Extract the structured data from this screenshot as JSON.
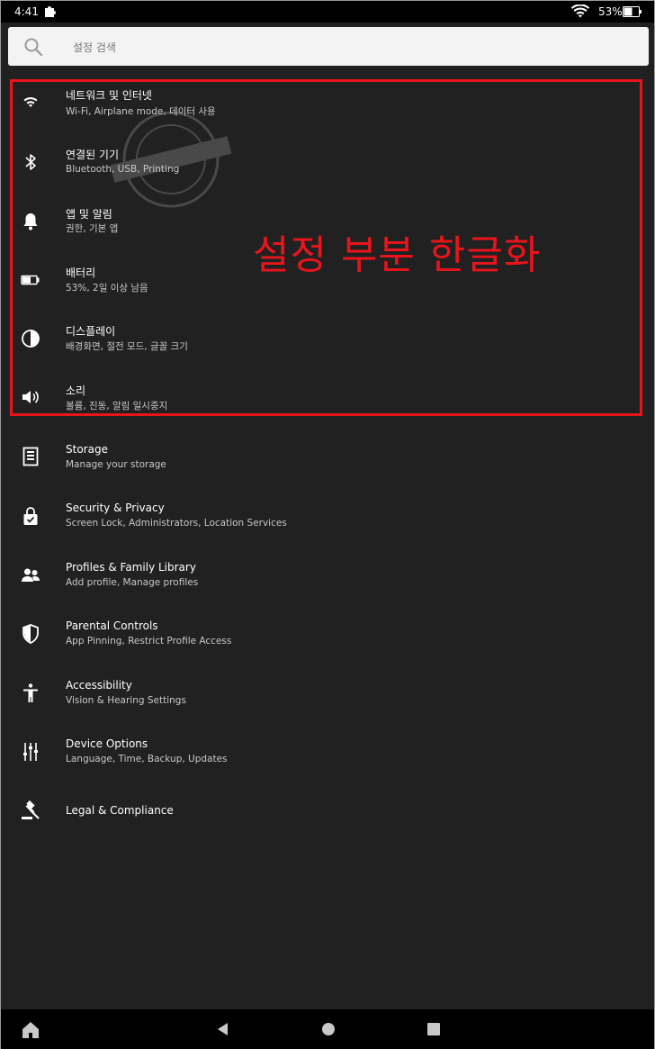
{
  "status_bar": {
    "time": "4:41",
    "battery_percent": "53%",
    "battery_level": 0.53,
    "icons": [
      "puzzle-icon",
      "wifi-icon",
      "battery-icon"
    ]
  },
  "search": {
    "placeholder": "설정 검색",
    "icon": "search-icon"
  },
  "settings": [
    {
      "icon": "wifi-icon",
      "title": "네트워크 및 인터넷",
      "subtitle": "Wi-Fi, Airplane mode, 데이터 사용"
    },
    {
      "icon": "bluetooth-icon",
      "title": "연결된 기기",
      "subtitle": "Bluetooth, USB, Printing"
    },
    {
      "icon": "bell-icon",
      "title": "앱 및 알림",
      "subtitle": "권한, 기본 앱"
    },
    {
      "icon": "battery-icon",
      "title": "배터리",
      "subtitle": "53%, 2일 이상 남음"
    },
    {
      "icon": "contrast-icon",
      "title": "디스플레이",
      "subtitle": "배경화면, 절전 모드, 글꼴 크기"
    },
    {
      "icon": "volume-icon",
      "title": "소리",
      "subtitle": "볼륨, 진동, 알림 일시중지"
    },
    {
      "icon": "storage-icon",
      "title": "Storage",
      "subtitle": "Manage your storage"
    },
    {
      "icon": "lock-icon",
      "title": "Security & Privacy",
      "subtitle": "Screen Lock, Administrators, Location Services"
    },
    {
      "icon": "profiles-icon",
      "title": "Profiles & Family Library",
      "subtitle": "Add profile, Manage profiles"
    },
    {
      "icon": "shield-icon",
      "title": "Parental Controls",
      "subtitle": "App Pinning, Restrict Profile Access"
    },
    {
      "icon": "accessibility-icon",
      "title": "Accessibility",
      "subtitle": "Vision & Hearing Settings"
    },
    {
      "icon": "sliders-icon",
      "title": "Device Options",
      "subtitle": "Language, Time, Backup, Updates"
    },
    {
      "icon": "gavel-icon",
      "title": "Legal & Compliance",
      "subtitle": ""
    }
  ],
  "annotation": {
    "text": "설정 부분 한글화",
    "color": "#e8141c"
  },
  "nav_bar": {
    "icons": [
      "home-icon",
      "back-icon",
      "home-circle-icon",
      "recents-icon"
    ]
  },
  "colors": {
    "background": "#212121",
    "status_bar": "#000000",
    "search_bg": "#f3f3f3",
    "accent_red": "#e8141c"
  }
}
